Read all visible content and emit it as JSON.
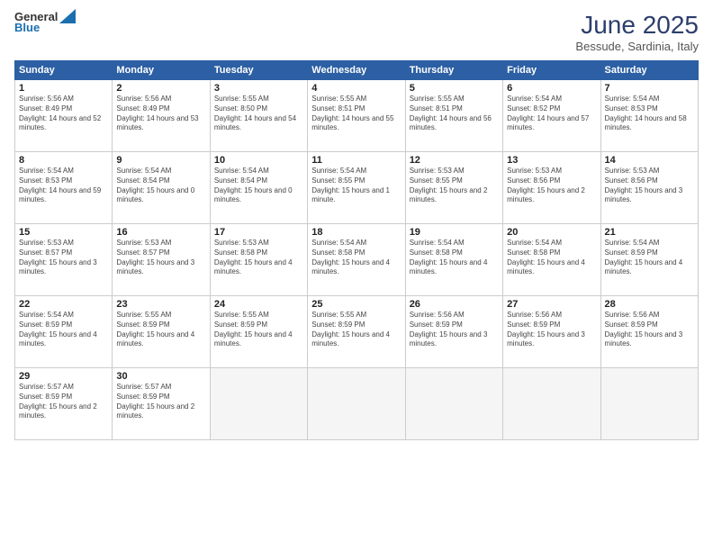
{
  "header": {
    "logo_general": "General",
    "logo_blue": "Blue",
    "month_title": "June 2025",
    "location": "Bessude, Sardinia, Italy"
  },
  "calendar": {
    "days_of_week": [
      "Sunday",
      "Monday",
      "Tuesday",
      "Wednesday",
      "Thursday",
      "Friday",
      "Saturday"
    ],
    "weeks": [
      [
        {
          "day": 1,
          "sunrise": "5:56 AM",
          "sunset": "8:49 PM",
          "daylight": "14 hours and 52 minutes."
        },
        {
          "day": 2,
          "sunrise": "5:56 AM",
          "sunset": "8:49 PM",
          "daylight": "14 hours and 53 minutes."
        },
        {
          "day": 3,
          "sunrise": "5:55 AM",
          "sunset": "8:50 PM",
          "daylight": "14 hours and 54 minutes."
        },
        {
          "day": 4,
          "sunrise": "5:55 AM",
          "sunset": "8:51 PM",
          "daylight": "14 hours and 55 minutes."
        },
        {
          "day": 5,
          "sunrise": "5:55 AM",
          "sunset": "8:51 PM",
          "daylight": "14 hours and 56 minutes."
        },
        {
          "day": 6,
          "sunrise": "5:54 AM",
          "sunset": "8:52 PM",
          "daylight": "14 hours and 57 minutes."
        },
        {
          "day": 7,
          "sunrise": "5:54 AM",
          "sunset": "8:53 PM",
          "daylight": "14 hours and 58 minutes."
        }
      ],
      [
        {
          "day": 8,
          "sunrise": "5:54 AM",
          "sunset": "8:53 PM",
          "daylight": "14 hours and 59 minutes."
        },
        {
          "day": 9,
          "sunrise": "5:54 AM",
          "sunset": "8:54 PM",
          "daylight": "15 hours and 0 minutes."
        },
        {
          "day": 10,
          "sunrise": "5:54 AM",
          "sunset": "8:54 PM",
          "daylight": "15 hours and 0 minutes."
        },
        {
          "day": 11,
          "sunrise": "5:54 AM",
          "sunset": "8:55 PM",
          "daylight": "15 hours and 1 minute."
        },
        {
          "day": 12,
          "sunrise": "5:53 AM",
          "sunset": "8:55 PM",
          "daylight": "15 hours and 2 minutes."
        },
        {
          "day": 13,
          "sunrise": "5:53 AM",
          "sunset": "8:56 PM",
          "daylight": "15 hours and 2 minutes."
        },
        {
          "day": 14,
          "sunrise": "5:53 AM",
          "sunset": "8:56 PM",
          "daylight": "15 hours and 3 minutes."
        }
      ],
      [
        {
          "day": 15,
          "sunrise": "5:53 AM",
          "sunset": "8:57 PM",
          "daylight": "15 hours and 3 minutes."
        },
        {
          "day": 16,
          "sunrise": "5:53 AM",
          "sunset": "8:57 PM",
          "daylight": "15 hours and 3 minutes."
        },
        {
          "day": 17,
          "sunrise": "5:53 AM",
          "sunset": "8:58 PM",
          "daylight": "15 hours and 4 minutes."
        },
        {
          "day": 18,
          "sunrise": "5:54 AM",
          "sunset": "8:58 PM",
          "daylight": "15 hours and 4 minutes."
        },
        {
          "day": 19,
          "sunrise": "5:54 AM",
          "sunset": "8:58 PM",
          "daylight": "15 hours and 4 minutes."
        },
        {
          "day": 20,
          "sunrise": "5:54 AM",
          "sunset": "8:58 PM",
          "daylight": "15 hours and 4 minutes."
        },
        {
          "day": 21,
          "sunrise": "5:54 AM",
          "sunset": "8:59 PM",
          "daylight": "15 hours and 4 minutes."
        }
      ],
      [
        {
          "day": 22,
          "sunrise": "5:54 AM",
          "sunset": "8:59 PM",
          "daylight": "15 hours and 4 minutes."
        },
        {
          "day": 23,
          "sunrise": "5:55 AM",
          "sunset": "8:59 PM",
          "daylight": "15 hours and 4 minutes."
        },
        {
          "day": 24,
          "sunrise": "5:55 AM",
          "sunset": "8:59 PM",
          "daylight": "15 hours and 4 minutes."
        },
        {
          "day": 25,
          "sunrise": "5:55 AM",
          "sunset": "8:59 PM",
          "daylight": "15 hours and 4 minutes."
        },
        {
          "day": 26,
          "sunrise": "5:56 AM",
          "sunset": "8:59 PM",
          "daylight": "15 hours and 3 minutes."
        },
        {
          "day": 27,
          "sunrise": "5:56 AM",
          "sunset": "8:59 PM",
          "daylight": "15 hours and 3 minutes."
        },
        {
          "day": 28,
          "sunrise": "5:56 AM",
          "sunset": "8:59 PM",
          "daylight": "15 hours and 3 minutes."
        }
      ],
      [
        {
          "day": 29,
          "sunrise": "5:57 AM",
          "sunset": "8:59 PM",
          "daylight": "15 hours and 2 minutes."
        },
        {
          "day": 30,
          "sunrise": "5:57 AM",
          "sunset": "8:59 PM",
          "daylight": "15 hours and 2 minutes."
        },
        null,
        null,
        null,
        null,
        null
      ]
    ]
  }
}
